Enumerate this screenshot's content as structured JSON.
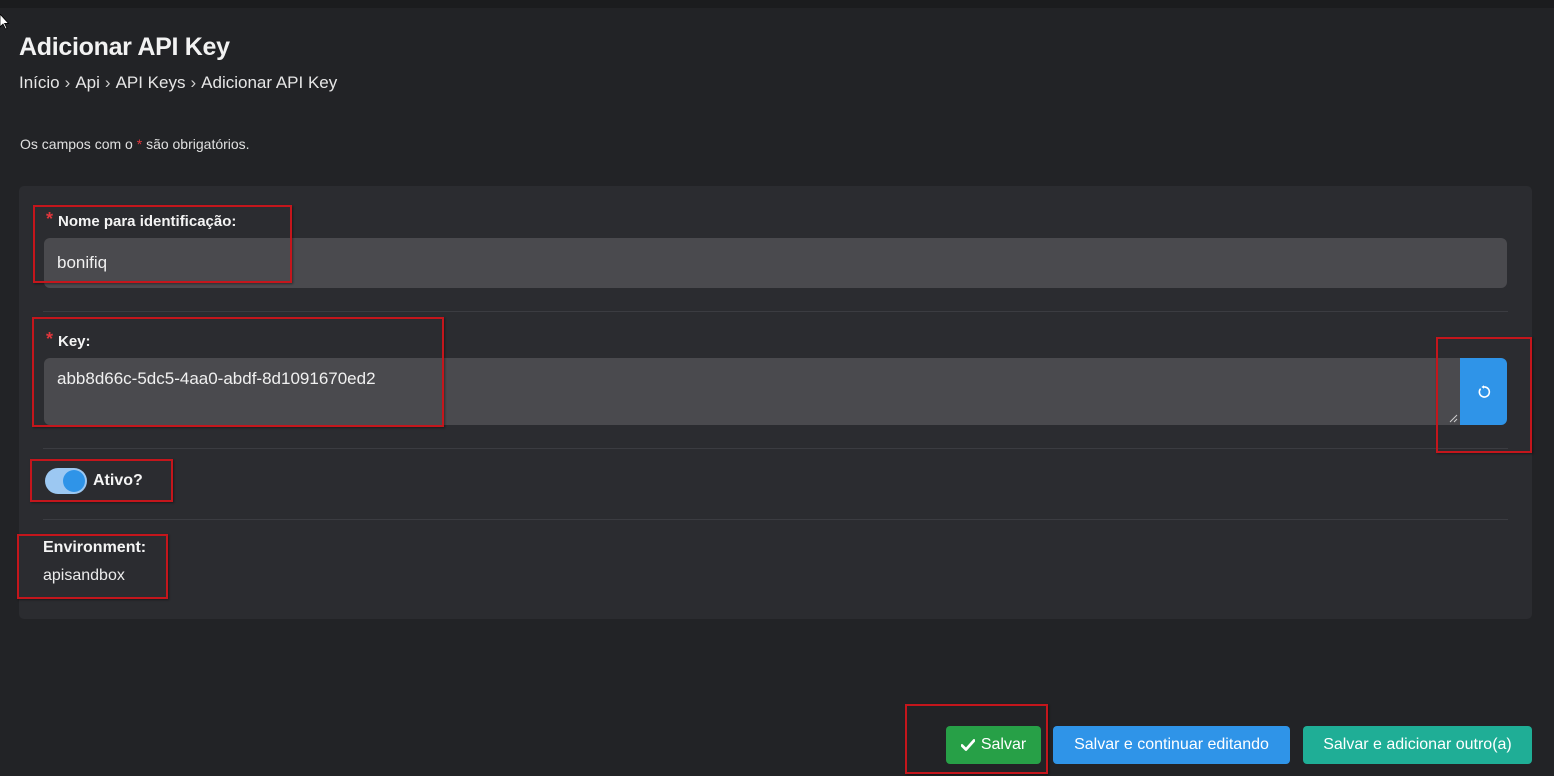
{
  "header": {
    "title": "Adicionar API Key"
  },
  "breadcrumb": {
    "items": [
      "Início",
      "Api",
      "API Keys",
      "Adicionar API Key"
    ],
    "separator": "›"
  },
  "form": {
    "required_note_prefix": "Os campos com o",
    "required_note_star": "*",
    "required_note_suffix": "são obrigatórios.",
    "name_field": {
      "label": "Nome para identificação:",
      "value": "bonifiq",
      "required": true
    },
    "key_field": {
      "label": "Key:",
      "value": "abb8d66c-5dc5-4aa0-abdf-8d1091670ed2",
      "required": true,
      "regenerate_icon": "refresh-icon"
    },
    "active_toggle": {
      "label": "Ativo?",
      "checked": true
    },
    "environment": {
      "label": "Environment:",
      "value": "apisandbox"
    }
  },
  "actions": {
    "save_label": "Salvar",
    "save_icon": "check-icon",
    "save_continue_label": "Salvar e continuar editando",
    "save_add_label": "Salvar e adicionar outro(a)"
  },
  "colors": {
    "background": "#222326",
    "panel": "#2b2c30",
    "input": "#4a4a4e",
    "primary": "#2f94e8",
    "success": "#27a047",
    "teal": "#1fae96",
    "required": "#e0363c",
    "annotation": "#c4161c"
  }
}
